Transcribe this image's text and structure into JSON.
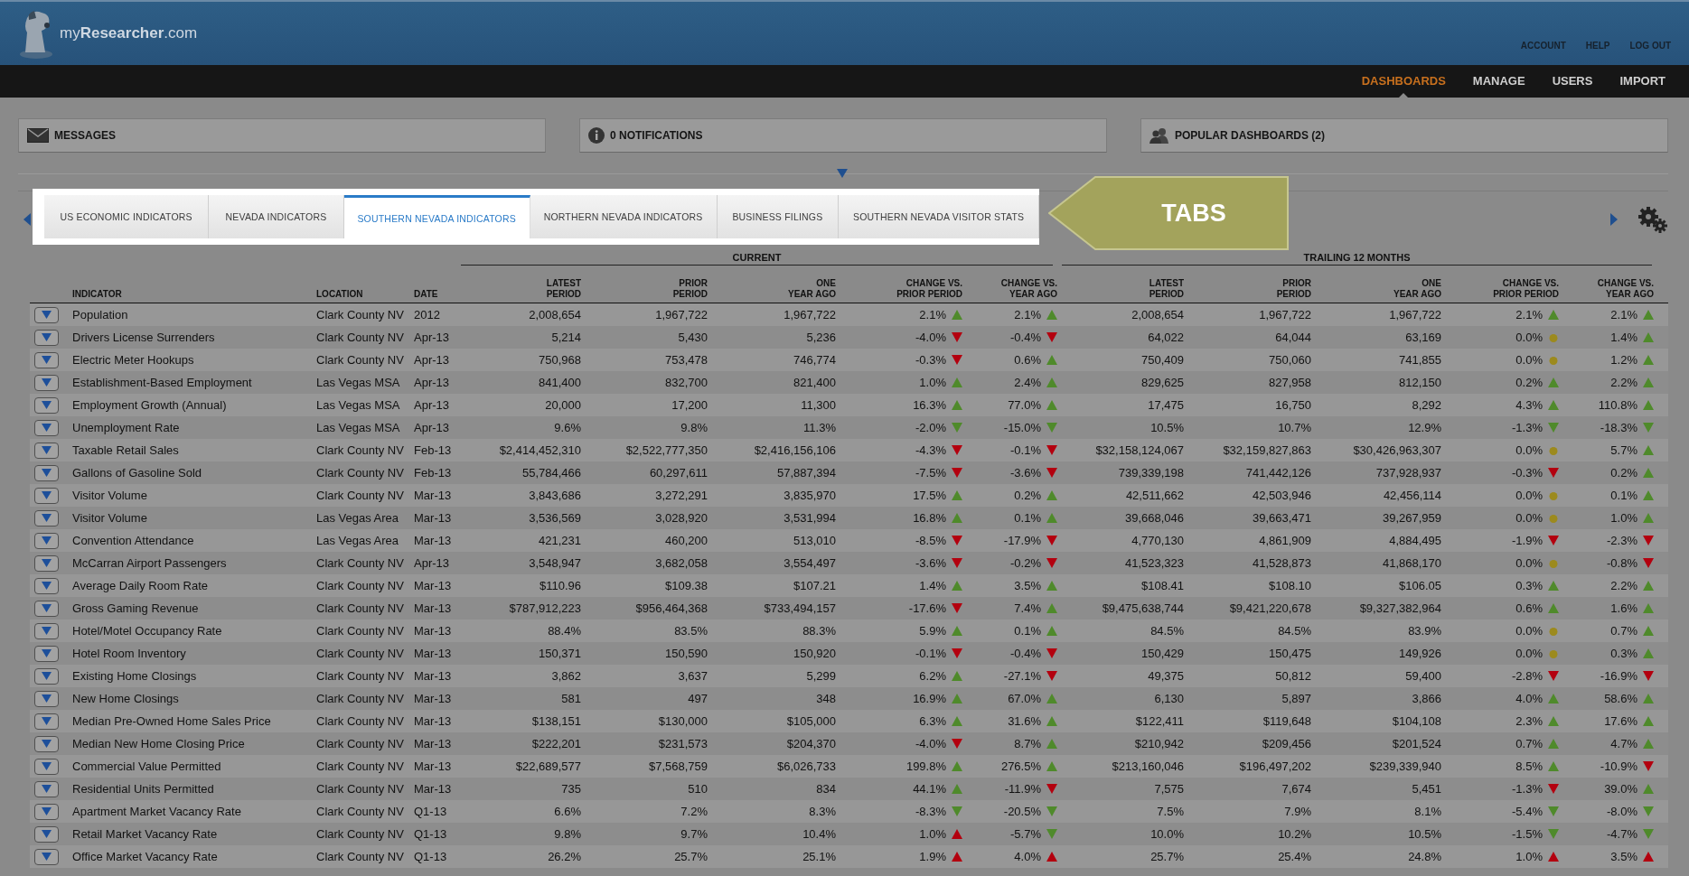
{
  "header": {
    "logo": "my**Researcher**.com",
    "links": [
      "ACCOUNT",
      "HELP",
      "LOG OUT"
    ]
  },
  "nav": [
    {
      "label": "DASHBOARDS",
      "selected": true
    },
    {
      "label": "MANAGE",
      "selected": false
    },
    {
      "label": "USERS",
      "selected": false
    },
    {
      "label": "IMPORT",
      "selected": false
    }
  ],
  "panels": [
    {
      "kind": "messages",
      "label": "MESSAGES"
    },
    {
      "kind": "notifications",
      "label": "0 NOTIFICATIONS"
    },
    {
      "kind": "popular",
      "label": "POPULAR DASHBOARDS (2)"
    }
  ],
  "tabs": [
    {
      "label": "US ECONOMIC INDICATORS",
      "selected": false
    },
    {
      "label": "NEVADA INDICATORS",
      "selected": false
    },
    {
      "label": "SOUTHERN NEVADA INDICATORS",
      "selected": true
    },
    {
      "label": "NORTHERN NEVADA INDICATORS",
      "selected": false
    },
    {
      "label": "BUSINESS FILINGS",
      "selected": false
    },
    {
      "label": "SOUTHERN NEVADA VISITOR STATS",
      "selected": false
    }
  ],
  "callout": "TABS",
  "table": {
    "groups": [
      "CURRENT",
      "TRAILING 12 MONTHS"
    ],
    "columns": [
      "INDICATOR",
      "LOCATION",
      "DATE",
      "LATEST\nPERIOD",
      "PRIOR\nPERIOD",
      "ONE\nYEAR AGO",
      "CHANGE VS.\nPRIOR PERIOD",
      "CHANGE VS.\nYEAR AGO",
      "LATEST\nPERIOD",
      "PRIOR\nPERIOD",
      "ONE\nYEAR AGO",
      "CHANGE VS.\nPRIOR PERIOD",
      "CHANGE VS.\nYEAR AGO"
    ],
    "rows": [
      {
        "indicator": "Population",
        "location": "Clark County NV",
        "date": "2012",
        "values": [
          "2,008,654",
          "1,967,722",
          "1,967,722",
          "2,008,654",
          "1,967,722",
          "1,967,722"
        ],
        "changes": [
          {
            "value": "2.1%",
            "kind": "up",
            "color": "#4f8a2b"
          },
          {
            "value": "2.1%",
            "kind": "up",
            "color": "#4f8a2b"
          },
          {
            "value": "2.1%",
            "kind": "up",
            "color": "#4f8a2b"
          },
          {
            "value": "2.1%",
            "kind": "up",
            "color": "#4f8a2b"
          }
        ]
      },
      {
        "indicator": "Drivers License Surrenders",
        "location": "Clark County NV",
        "date": "Apr-13",
        "values": [
          "5,214",
          "5,430",
          "5,236",
          "64,022",
          "64,044",
          "63,169"
        ],
        "changes": [
          {
            "value": "-4.0%",
            "kind": "down",
            "color": "#b3000f"
          },
          {
            "value": "-0.4%",
            "kind": "down",
            "color": "#b3000f"
          },
          {
            "value": "0.0%",
            "kind": "flat",
            "color": "#9c8a1e"
          },
          {
            "value": "1.4%",
            "kind": "up",
            "color": "#4f8a2b"
          }
        ]
      },
      {
        "indicator": "Electric Meter Hookups",
        "location": "Clark County NV",
        "date": "Apr-13",
        "values": [
          "750,968",
          "753,478",
          "746,774",
          "750,409",
          "750,060",
          "741,855"
        ],
        "changes": [
          {
            "value": "-0.3%",
            "kind": "down",
            "color": "#b3000f"
          },
          {
            "value": "0.6%",
            "kind": "up",
            "color": "#4f8a2b"
          },
          {
            "value": "0.0%",
            "kind": "flat",
            "color": "#9c8a1e"
          },
          {
            "value": "1.2%",
            "kind": "up",
            "color": "#4f8a2b"
          }
        ]
      },
      {
        "indicator": "Establishment-Based Employment",
        "location": "Las Vegas MSA",
        "date": "Apr-13",
        "values": [
          "841,400",
          "832,700",
          "821,400",
          "829,625",
          "827,958",
          "812,150"
        ],
        "changes": [
          {
            "value": "1.0%",
            "kind": "up",
            "color": "#4f8a2b"
          },
          {
            "value": "2.4%",
            "kind": "up",
            "color": "#4f8a2b"
          },
          {
            "value": "0.2%",
            "kind": "up",
            "color": "#4f8a2b"
          },
          {
            "value": "2.2%",
            "kind": "up",
            "color": "#4f8a2b"
          }
        ]
      },
      {
        "indicator": "Employment Growth (Annual)",
        "location": "Las Vegas MSA",
        "date": "Apr-13",
        "values": [
          "20,000",
          "17,200",
          "11,300",
          "17,475",
          "16,750",
          "8,292"
        ],
        "changes": [
          {
            "value": "16.3%",
            "kind": "up",
            "color": "#4f8a2b"
          },
          {
            "value": "77.0%",
            "kind": "up",
            "color": "#4f8a2b"
          },
          {
            "value": "4.3%",
            "kind": "up",
            "color": "#4f8a2b"
          },
          {
            "value": "110.8%",
            "kind": "up",
            "color": "#4f8a2b"
          }
        ]
      },
      {
        "indicator": "Unemployment Rate",
        "location": "Las Vegas MSA",
        "date": "Apr-13",
        "values": [
          "9.6%",
          "9.8%",
          "11.3%",
          "10.5%",
          "10.7%",
          "12.9%"
        ],
        "changes": [
          {
            "value": "-2.0%",
            "kind": "down",
            "color": "#4f8a2b"
          },
          {
            "value": "-15.0%",
            "kind": "down",
            "color": "#4f8a2b"
          },
          {
            "value": "-1.3%",
            "kind": "down",
            "color": "#4f8a2b"
          },
          {
            "value": "-18.3%",
            "kind": "down",
            "color": "#4f8a2b"
          }
        ]
      },
      {
        "indicator": "Taxable Retail Sales",
        "location": "Clark County NV",
        "date": "Feb-13",
        "values": [
          "$2,414,452,310",
          "$2,522,777,350",
          "$2,416,156,106",
          "$32,158,124,067",
          "$32,159,827,863",
          "$30,426,963,307"
        ],
        "changes": [
          {
            "value": "-4.3%",
            "kind": "down",
            "color": "#b3000f"
          },
          {
            "value": "-0.1%",
            "kind": "down",
            "color": "#b3000f"
          },
          {
            "value": "0.0%",
            "kind": "flat",
            "color": "#9c8a1e"
          },
          {
            "value": "5.7%",
            "kind": "up",
            "color": "#4f8a2b"
          }
        ]
      },
      {
        "indicator": "Gallons of Gasoline Sold",
        "location": "Clark County NV",
        "date": "Feb-13",
        "values": [
          "55,784,466",
          "60,297,611",
          "57,887,394",
          "739,339,198",
          "741,442,126",
          "737,928,937"
        ],
        "changes": [
          {
            "value": "-7.5%",
            "kind": "down",
            "color": "#b3000f"
          },
          {
            "value": "-3.6%",
            "kind": "down",
            "color": "#b3000f"
          },
          {
            "value": "-0.3%",
            "kind": "down",
            "color": "#b3000f"
          },
          {
            "value": "0.2%",
            "kind": "up",
            "color": "#4f8a2b"
          }
        ]
      },
      {
        "indicator": "Visitor Volume",
        "location": "Clark County NV",
        "date": "Mar-13",
        "values": [
          "3,843,686",
          "3,272,291",
          "3,835,970",
          "42,511,662",
          "42,503,946",
          "42,456,114"
        ],
        "changes": [
          {
            "value": "17.5%",
            "kind": "up",
            "color": "#4f8a2b"
          },
          {
            "value": "0.2%",
            "kind": "up",
            "color": "#4f8a2b"
          },
          {
            "value": "0.0%",
            "kind": "flat",
            "color": "#9c8a1e"
          },
          {
            "value": "0.1%",
            "kind": "up",
            "color": "#4f8a2b"
          }
        ]
      },
      {
        "indicator": "Visitor Volume",
        "location": "Las Vegas Area",
        "date": "Mar-13",
        "values": [
          "3,536,569",
          "3,028,920",
          "3,531,994",
          "39,668,046",
          "39,663,471",
          "39,267,959"
        ],
        "changes": [
          {
            "value": "16.8%",
            "kind": "up",
            "color": "#4f8a2b"
          },
          {
            "value": "0.1%",
            "kind": "up",
            "color": "#4f8a2b"
          },
          {
            "value": "0.0%",
            "kind": "flat",
            "color": "#9c8a1e"
          },
          {
            "value": "1.0%",
            "kind": "up",
            "color": "#4f8a2b"
          }
        ]
      },
      {
        "indicator": "Convention Attendance",
        "location": "Las Vegas Area",
        "date": "Mar-13",
        "values": [
          "421,231",
          "460,200",
          "513,010",
          "4,770,130",
          "4,861,909",
          "4,884,495"
        ],
        "changes": [
          {
            "value": "-8.5%",
            "kind": "down",
            "color": "#b3000f"
          },
          {
            "value": "-17.9%",
            "kind": "down",
            "color": "#b3000f"
          },
          {
            "value": "-1.9%",
            "kind": "down",
            "color": "#b3000f"
          },
          {
            "value": "-2.3%",
            "kind": "down",
            "color": "#b3000f"
          }
        ]
      },
      {
        "indicator": "McCarran Airport Passengers",
        "location": "Clark County NV",
        "date": "Apr-13",
        "values": [
          "3,548,947",
          "3,682,058",
          "3,554,497",
          "41,523,323",
          "41,528,873",
          "41,868,170"
        ],
        "changes": [
          {
            "value": "-3.6%",
            "kind": "down",
            "color": "#b3000f"
          },
          {
            "value": "-0.2%",
            "kind": "down",
            "color": "#b3000f"
          },
          {
            "value": "0.0%",
            "kind": "flat",
            "color": "#9c8a1e"
          },
          {
            "value": "-0.8%",
            "kind": "down",
            "color": "#b3000f"
          }
        ]
      },
      {
        "indicator": "Average Daily Room Rate",
        "location": "Clark County NV",
        "date": "Mar-13",
        "values": [
          "$110.96",
          "$109.38",
          "$107.21",
          "$108.41",
          "$108.10",
          "$106.05"
        ],
        "changes": [
          {
            "value": "1.4%",
            "kind": "up",
            "color": "#4f8a2b"
          },
          {
            "value": "3.5%",
            "kind": "up",
            "color": "#4f8a2b"
          },
          {
            "value": "0.3%",
            "kind": "up",
            "color": "#4f8a2b"
          },
          {
            "value": "2.2%",
            "kind": "up",
            "color": "#4f8a2b"
          }
        ]
      },
      {
        "indicator": "Gross Gaming Revenue",
        "location": "Clark County NV",
        "date": "Mar-13",
        "values": [
          "$787,912,223",
          "$956,464,368",
          "$733,494,157",
          "$9,475,638,744",
          "$9,421,220,678",
          "$9,327,382,964"
        ],
        "changes": [
          {
            "value": "-17.6%",
            "kind": "down",
            "color": "#b3000f"
          },
          {
            "value": "7.4%",
            "kind": "up",
            "color": "#4f8a2b"
          },
          {
            "value": "0.6%",
            "kind": "up",
            "color": "#4f8a2b"
          },
          {
            "value": "1.6%",
            "kind": "up",
            "color": "#4f8a2b"
          }
        ]
      },
      {
        "indicator": "Hotel/Motel Occupancy Rate",
        "location": "Clark County NV",
        "date": "Mar-13",
        "values": [
          "88.4%",
          "83.5%",
          "88.3%",
          "84.5%",
          "84.5%",
          "83.9%"
        ],
        "changes": [
          {
            "value": "5.9%",
            "kind": "up",
            "color": "#4f8a2b"
          },
          {
            "value": "0.1%",
            "kind": "up",
            "color": "#4f8a2b"
          },
          {
            "value": "0.0%",
            "kind": "flat",
            "color": "#9c8a1e"
          },
          {
            "value": "0.7%",
            "kind": "up",
            "color": "#4f8a2b"
          }
        ]
      },
      {
        "indicator": "Hotel Room Inventory",
        "location": "Clark County NV",
        "date": "Mar-13",
        "values": [
          "150,371",
          "150,590",
          "150,920",
          "150,429",
          "150,475",
          "149,926"
        ],
        "changes": [
          {
            "value": "-0.1%",
            "kind": "down",
            "color": "#b3000f"
          },
          {
            "value": "-0.4%",
            "kind": "down",
            "color": "#b3000f"
          },
          {
            "value": "0.0%",
            "kind": "flat",
            "color": "#9c8a1e"
          },
          {
            "value": "0.3%",
            "kind": "up",
            "color": "#4f8a2b"
          }
        ]
      },
      {
        "indicator": "Existing Home Closings",
        "location": "Clark County NV",
        "date": "Mar-13",
        "values": [
          "3,862",
          "3,637",
          "5,299",
          "49,375",
          "50,812",
          "59,400"
        ],
        "changes": [
          {
            "value": "6.2%",
            "kind": "up",
            "color": "#4f8a2b"
          },
          {
            "value": "-27.1%",
            "kind": "down",
            "color": "#b3000f"
          },
          {
            "value": "-2.8%",
            "kind": "down",
            "color": "#b3000f"
          },
          {
            "value": "-16.9%",
            "kind": "down",
            "color": "#b3000f"
          }
        ]
      },
      {
        "indicator": "New Home Closings",
        "location": "Clark County NV",
        "date": "Mar-13",
        "values": [
          "581",
          "497",
          "348",
          "6,130",
          "5,897",
          "3,866"
        ],
        "changes": [
          {
            "value": "16.9%",
            "kind": "up",
            "color": "#4f8a2b"
          },
          {
            "value": "67.0%",
            "kind": "up",
            "color": "#4f8a2b"
          },
          {
            "value": "4.0%",
            "kind": "up",
            "color": "#4f8a2b"
          },
          {
            "value": "58.6%",
            "kind": "up",
            "color": "#4f8a2b"
          }
        ]
      },
      {
        "indicator": "Median Pre-Owned Home Sales Price",
        "location": "Clark County NV",
        "date": "Mar-13",
        "values": [
          "$138,151",
          "$130,000",
          "$105,000",
          "$122,411",
          "$119,648",
          "$104,108"
        ],
        "changes": [
          {
            "value": "6.3%",
            "kind": "up",
            "color": "#4f8a2b"
          },
          {
            "value": "31.6%",
            "kind": "up",
            "color": "#4f8a2b"
          },
          {
            "value": "2.3%",
            "kind": "up",
            "color": "#4f8a2b"
          },
          {
            "value": "17.6%",
            "kind": "up",
            "color": "#4f8a2b"
          }
        ]
      },
      {
        "indicator": "Median New Home Closing Price",
        "location": "Clark County NV",
        "date": "Mar-13",
        "values": [
          "$222,201",
          "$231,573",
          "$204,370",
          "$210,942",
          "$209,456",
          "$201,524"
        ],
        "changes": [
          {
            "value": "-4.0%",
            "kind": "down",
            "color": "#b3000f"
          },
          {
            "value": "8.7%",
            "kind": "up",
            "color": "#4f8a2b"
          },
          {
            "value": "0.7%",
            "kind": "up",
            "color": "#4f8a2b"
          },
          {
            "value": "4.7%",
            "kind": "up",
            "color": "#4f8a2b"
          }
        ]
      },
      {
        "indicator": "Commercial Value Permitted",
        "location": "Clark County NV",
        "date": "Mar-13",
        "values": [
          "$22,689,577",
          "$7,568,759",
          "$6,026,733",
          "$213,160,046",
          "$196,497,202",
          "$239,339,940"
        ],
        "changes": [
          {
            "value": "199.8%",
            "kind": "up",
            "color": "#4f8a2b"
          },
          {
            "value": "276.5%",
            "kind": "up",
            "color": "#4f8a2b"
          },
          {
            "value": "8.5%",
            "kind": "up",
            "color": "#4f8a2b"
          },
          {
            "value": "-10.9%",
            "kind": "down",
            "color": "#b3000f"
          }
        ]
      },
      {
        "indicator": "Residential Units Permitted",
        "location": "Clark County NV",
        "date": "Mar-13",
        "values": [
          "735",
          "510",
          "834",
          "7,575",
          "7,674",
          "5,451"
        ],
        "changes": [
          {
            "value": "44.1%",
            "kind": "up",
            "color": "#4f8a2b"
          },
          {
            "value": "-11.9%",
            "kind": "down",
            "color": "#b3000f"
          },
          {
            "value": "-1.3%",
            "kind": "down",
            "color": "#b3000f"
          },
          {
            "value": "39.0%",
            "kind": "up",
            "color": "#4f8a2b"
          }
        ]
      },
      {
        "indicator": "Apartment Market Vacancy Rate",
        "location": "Clark County NV",
        "date": "Q1-13",
        "values": [
          "6.6%",
          "7.2%",
          "8.3%",
          "7.5%",
          "7.9%",
          "8.1%"
        ],
        "changes": [
          {
            "value": "-8.3%",
            "kind": "down",
            "color": "#4f8a2b"
          },
          {
            "value": "-20.5%",
            "kind": "down",
            "color": "#4f8a2b"
          },
          {
            "value": "-5.4%",
            "kind": "down",
            "color": "#4f8a2b"
          },
          {
            "value": "-8.0%",
            "kind": "down",
            "color": "#4f8a2b"
          }
        ]
      },
      {
        "indicator": "Retail Market Vacancy Rate",
        "location": "Clark County NV",
        "date": "Q1-13",
        "values": [
          "9.8%",
          "9.7%",
          "10.4%",
          "10.0%",
          "10.2%",
          "10.5%"
        ],
        "changes": [
          {
            "value": "1.0%",
            "kind": "up",
            "color": "#b3000f"
          },
          {
            "value": "-5.7%",
            "kind": "down",
            "color": "#4f8a2b"
          },
          {
            "value": "-1.5%",
            "kind": "down",
            "color": "#4f8a2b"
          },
          {
            "value": "-4.7%",
            "kind": "down",
            "color": "#4f8a2b"
          }
        ]
      },
      {
        "indicator": "Office Market Vacancy Rate",
        "location": "Clark County NV",
        "date": "Q1-13",
        "values": [
          "26.2%",
          "25.7%",
          "25.1%",
          "25.7%",
          "25.4%",
          "24.8%"
        ],
        "changes": [
          {
            "value": "1.9%",
            "kind": "up",
            "color": "#b3000f"
          },
          {
            "value": "4.0%",
            "kind": "up",
            "color": "#b3000f"
          },
          {
            "value": "1.0%",
            "kind": "up",
            "color": "#b3000f"
          },
          {
            "value": "3.5%",
            "kind": "up",
            "color": "#b3000f"
          }
        ]
      }
    ]
  }
}
